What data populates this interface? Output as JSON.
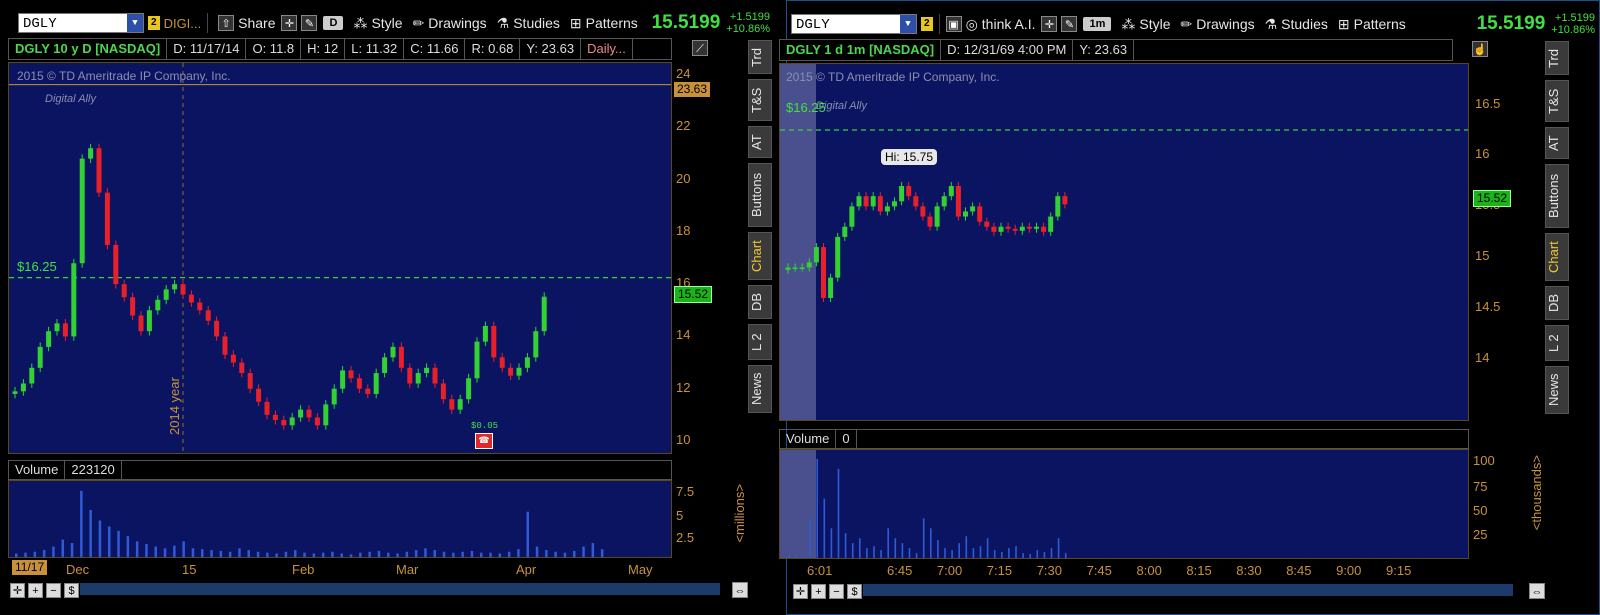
{
  "left": {
    "symbol": "DGLY",
    "link_badge": "2",
    "link_name": "DIGI...",
    "toolbar": {
      "share": "Share",
      "aggregation": "D",
      "style": "Style",
      "drawings": "Drawings",
      "studies": "Studies",
      "patterns": "Patterns"
    },
    "last_price": "15.5199",
    "change_abs": "+1.5199",
    "change_pct": "+10.86%",
    "header": {
      "title": "DGLY 10 y D [NASDAQ]",
      "date": "D: 11/17/14",
      "open": "O: 11.8",
      "high": "H: 12",
      "low": "L: 11.32",
      "close": "C: 11.66",
      "range": "R: 0.68",
      "year": "Y: 23.63",
      "period": "Daily..."
    },
    "copyright": "2015 © TD Ameritrade IP Company, Inc.",
    "watermark": "Digital Ally",
    "price_line_label": "$16.25",
    "year_marker": "2014 year",
    "y_axis": [
      "24",
      "22",
      "20",
      "18",
      "16",
      "14",
      "12",
      "10"
    ],
    "high_tag": "23.63",
    "last_tag": "15.52",
    "event_label": "$0.05",
    "volume_label": "Volume",
    "volume_value": "223120",
    "volume_axis": [
      "7.5",
      "5",
      "2.5"
    ],
    "volume_unit": "<millions>",
    "x_axis": [
      "Dec",
      "15",
      "Feb",
      "Mar",
      "Apr",
      "May"
    ],
    "cursor_date": "11/17",
    "colors": {
      "bg": "#0b1461",
      "up": "#32d232",
      "down": "#e8202a",
      "accent": "#c9923a"
    }
  },
  "right": {
    "symbol": "DGLY",
    "link_badge": "2",
    "toolbar": {
      "thinkai": "think A.I.",
      "aggregation": "1m",
      "style": "Style",
      "drawings": "Drawings",
      "studies": "Studies",
      "patterns": "Patterns"
    },
    "last_price": "15.5199",
    "change_abs": "+1.5199",
    "change_pct": "+10.86%",
    "header": {
      "title": "DGLY 1 d 1m [NASDAQ]",
      "date": "D: 12/31/69 4:00 PM",
      "year": "Y: 23.63"
    },
    "copyright": "2015 © TD Ameritrade IP Company, Inc.",
    "watermark": "Digital Ally",
    "price_line_label": "$16.25",
    "hi_label": "Hi: 15.75",
    "y_axis": [
      "16.5",
      "16",
      "15.5",
      "15",
      "14.5",
      "14"
    ],
    "last_tag": "15.52",
    "volume_label": "Volume",
    "volume_value": "0",
    "volume_axis": [
      "100",
      "75",
      "50",
      "25"
    ],
    "volume_unit": "<thousands>",
    "x_axis": [
      "6:01",
      "6:45",
      "7:00",
      "7:15",
      "7:30",
      "7:45",
      "8:00",
      "8:15",
      "8:30",
      "8:45",
      "9:00",
      "9:15"
    ]
  },
  "side_tabs": [
    "Trd",
    "T&S",
    "AT",
    "Buttons",
    "Chart",
    "DB",
    "L 2",
    "News"
  ],
  "chart_data": [
    {
      "type": "candlestick",
      "title": "DGLY 10 y D [NASDAQ]",
      "ylim": [
        10,
        24
      ],
      "price_line": 16.25,
      "series": [
        {
          "name": "DGLY daily",
          "close": [
            11.9,
            12.2,
            12.8,
            13.6,
            14.2,
            14.5,
            14.0,
            16.8,
            20.8,
            21.2,
            19.5,
            17.5,
            16.0,
            15.5,
            14.8,
            14.2,
            15.0,
            15.4,
            15.8,
            16.0,
            15.6,
            15.3,
            15.0,
            14.6,
            14.0,
            13.3,
            13.0,
            12.6,
            12.0,
            11.5,
            11.0,
            10.8,
            10.6,
            10.9,
            11.2,
            10.9,
            10.6,
            11.4,
            12.0,
            12.7,
            12.4,
            12.0,
            11.8,
            12.6,
            13.2,
            13.6,
            12.8,
            12.2,
            12.6,
            12.8,
            12.2,
            11.6,
            11.2,
            11.6,
            12.4,
            13.8,
            14.4,
            13.2,
            12.8,
            12.5,
            12.8,
            13.2,
            14.2,
            15.52
          ]
        }
      ]
    },
    {
      "type": "candlestick",
      "title": "DGLY 1 d 1m [NASDAQ]",
      "ylim": [
        13.5,
        16.8
      ],
      "price_line": 16.25,
      "series": [
        {
          "name": "DGLY 1m",
          "close": [
            14.9,
            14.9,
            14.9,
            14.95,
            15.1,
            14.6,
            14.8,
            15.2,
            15.3,
            15.5,
            15.6,
            15.5,
            15.6,
            15.45,
            15.5,
            15.55,
            15.7,
            15.6,
            15.5,
            15.4,
            15.3,
            15.5,
            15.6,
            15.7,
            15.4,
            15.45,
            15.5,
            15.35,
            15.3,
            15.25,
            15.3,
            15.28,
            15.26,
            15.3,
            15.28,
            15.3,
            15.25,
            15.4,
            15.6,
            15.52
          ]
        }
      ]
    }
  ]
}
